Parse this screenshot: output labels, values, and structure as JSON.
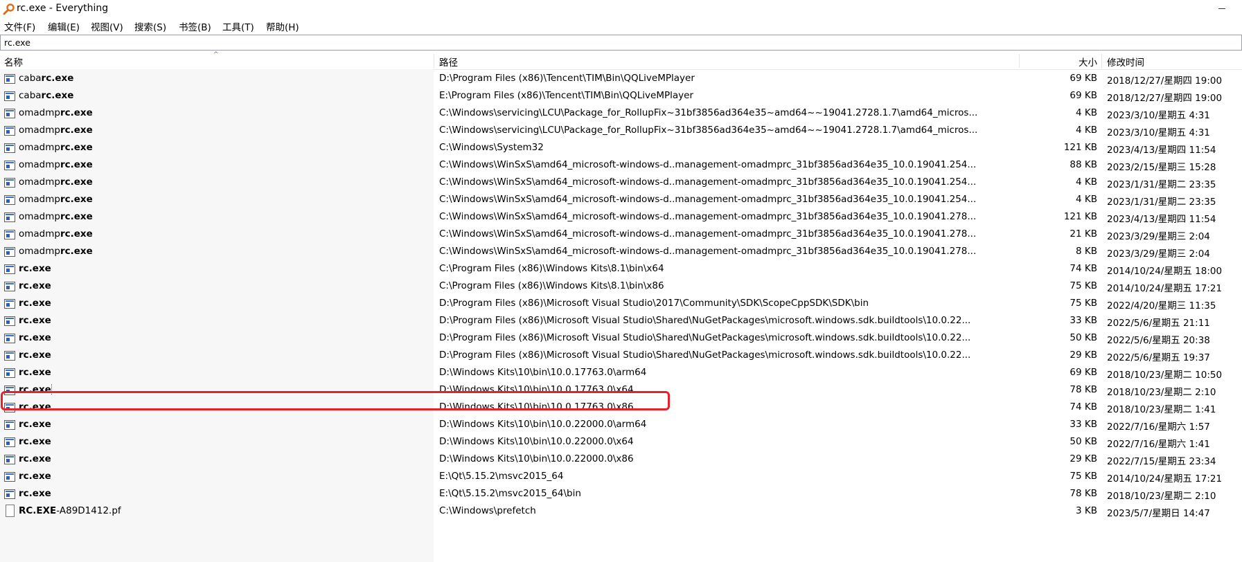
{
  "window": {
    "title": "rc.exe - Everything"
  },
  "menu": [
    {
      "label": "文件(F)"
    },
    {
      "label": "编辑(E)"
    },
    {
      "label": "视图(V)"
    },
    {
      "label": "搜索(S)"
    },
    {
      "label": "书签(B)"
    },
    {
      "label": "工具(T)"
    },
    {
      "label": "帮助(H)"
    }
  ],
  "search": {
    "value": "rc.exe"
  },
  "columns": {
    "name": "名称",
    "path": "路径",
    "size": "大小",
    "modified": "修改时间"
  },
  "colors": {
    "annotation": "#e8202a",
    "icon_blue": "#2d5fb8"
  },
  "annotation": {
    "highlighted_row_index": 18
  },
  "rows": [
    {
      "prefix": "caba",
      "match": "rc.exe",
      "suffix": "",
      "icon": "exe-icon",
      "path": "D:\\Program Files (x86)\\Tencent\\TIM\\Bin\\QQLiveMPlayer",
      "size": "69 KB",
      "modified": "2018/12/27/星期四 19:00"
    },
    {
      "prefix": "caba",
      "match": "rc.exe",
      "suffix": "",
      "icon": "exe-icon",
      "path": "E:\\Program Files (x86)\\Tencent\\TIM\\Bin\\QQLiveMPlayer",
      "size": "69 KB",
      "modified": "2018/12/27/星期四 19:00"
    },
    {
      "prefix": "omadmp",
      "match": "rc.exe",
      "suffix": "",
      "icon": "exe-icon",
      "path": "C:\\Windows\\servicing\\LCU\\Package_for_RollupFix~31bf3856ad364e35~amd64~~19041.2728.1.7\\amd64_micros...",
      "size": "4 KB",
      "modified": "2023/3/10/星期五 4:31"
    },
    {
      "prefix": "omadmp",
      "match": "rc.exe",
      "suffix": "",
      "icon": "exe-icon",
      "path": "C:\\Windows\\servicing\\LCU\\Package_for_RollupFix~31bf3856ad364e35~amd64~~19041.2728.1.7\\amd64_micros...",
      "size": "4 KB",
      "modified": "2023/3/10/星期五 4:31"
    },
    {
      "prefix": "omadmp",
      "match": "rc.exe",
      "suffix": "",
      "icon": "exe-icon",
      "path": "C:\\Windows\\System32",
      "size": "121 KB",
      "modified": "2023/4/13/星期四 11:54"
    },
    {
      "prefix": "omadmp",
      "match": "rc.exe",
      "suffix": "",
      "icon": "exe-icon",
      "path": "C:\\Windows\\WinSxS\\amd64_microsoft-windows-d..management-omadmprc_31bf3856ad364e35_10.0.19041.254...",
      "size": "88 KB",
      "modified": "2023/2/15/星期三 15:28"
    },
    {
      "prefix": "omadmp",
      "match": "rc.exe",
      "suffix": "",
      "icon": "exe-icon",
      "path": "C:\\Windows\\WinSxS\\amd64_microsoft-windows-d..management-omadmprc_31bf3856ad364e35_10.0.19041.254...",
      "size": "4 KB",
      "modified": "2023/1/31/星期二 23:35"
    },
    {
      "prefix": "omadmp",
      "match": "rc.exe",
      "suffix": "",
      "icon": "exe-icon",
      "path": "C:\\Windows\\WinSxS\\amd64_microsoft-windows-d..management-omadmprc_31bf3856ad364e35_10.0.19041.254...",
      "size": "4 KB",
      "modified": "2023/1/31/星期二 23:35"
    },
    {
      "prefix": "omadmp",
      "match": "rc.exe",
      "suffix": "",
      "icon": "exe-icon",
      "path": "C:\\Windows\\WinSxS\\amd64_microsoft-windows-d..management-omadmprc_31bf3856ad364e35_10.0.19041.278...",
      "size": "121 KB",
      "modified": "2023/4/13/星期四 11:54"
    },
    {
      "prefix": "omadmp",
      "match": "rc.exe",
      "suffix": "",
      "icon": "exe-icon",
      "path": "C:\\Windows\\WinSxS\\amd64_microsoft-windows-d..management-omadmprc_31bf3856ad364e35_10.0.19041.278...",
      "size": "21 KB",
      "modified": "2023/3/29/星期三 2:04"
    },
    {
      "prefix": "omadmp",
      "match": "rc.exe",
      "suffix": "",
      "icon": "exe-icon",
      "path": "C:\\Windows\\WinSxS\\amd64_microsoft-windows-d..management-omadmprc_31bf3856ad364e35_10.0.19041.278...",
      "size": "8 KB",
      "modified": "2023/3/29/星期三 2:04"
    },
    {
      "prefix": "",
      "match": "rc.exe",
      "suffix": "",
      "icon": "exe-icon",
      "path": "C:\\Program Files (x86)\\Windows Kits\\8.1\\bin\\x64",
      "size": "74 KB",
      "modified": "2014/10/24/星期五 18:00"
    },
    {
      "prefix": "",
      "match": "rc.exe",
      "suffix": "",
      "icon": "exe-icon",
      "path": "C:\\Program Files (x86)\\Windows Kits\\8.1\\bin\\x86",
      "size": "75 KB",
      "modified": "2014/10/24/星期五 17:21"
    },
    {
      "prefix": "",
      "match": "rc.exe",
      "suffix": "",
      "icon": "exe-icon",
      "path": "D:\\Program Files (x86)\\Microsoft Visual Studio\\2017\\Community\\SDK\\ScopeCppSDK\\SDK\\bin",
      "size": "75 KB",
      "modified": "2022/4/20/星期三 11:35"
    },
    {
      "prefix": "",
      "match": "rc.exe",
      "suffix": "",
      "icon": "exe-icon",
      "path": "D:\\Program Files (x86)\\Microsoft Visual Studio\\Shared\\NuGetPackages\\microsoft.windows.sdk.buildtools\\10.0.22...",
      "size": "33 KB",
      "modified": "2022/5/6/星期五 21:11"
    },
    {
      "prefix": "",
      "match": "rc.exe",
      "suffix": "",
      "icon": "exe-icon",
      "path": "D:\\Program Files (x86)\\Microsoft Visual Studio\\Shared\\NuGetPackages\\microsoft.windows.sdk.buildtools\\10.0.22...",
      "size": "50 KB",
      "modified": "2022/5/6/星期五 20:38"
    },
    {
      "prefix": "",
      "match": "rc.exe",
      "suffix": "",
      "icon": "exe-icon",
      "path": "D:\\Program Files (x86)\\Microsoft Visual Studio\\Shared\\NuGetPackages\\microsoft.windows.sdk.buildtools\\10.0.22...",
      "size": "29 KB",
      "modified": "2022/5/6/星期五 19:37"
    },
    {
      "prefix": "",
      "match": "rc.exe",
      "suffix": "",
      "icon": "exe-icon",
      "path": "D:\\Windows Kits\\10\\bin\\10.0.17763.0\\arm64",
      "size": "69 KB",
      "modified": "2018/10/23/星期二 10:50"
    },
    {
      "prefix": "",
      "match": "rc.exe",
      "suffix": "",
      "icon": "exe-icon",
      "path": "D:\\Windows Kits\\10\\bin\\10.0.17763.0\\x64",
      "size": "78 KB",
      "modified": "2018/10/23/星期二 2:10"
    },
    {
      "prefix": "",
      "match": "rc.exe",
      "suffix": "",
      "icon": "exe-icon",
      "path": "D:\\Windows Kits\\10\\bin\\10.0.17763.0\\x86",
      "size": "74 KB",
      "modified": "2018/10/23/星期二 1:41"
    },
    {
      "prefix": "",
      "match": "rc.exe",
      "suffix": "",
      "icon": "exe-icon",
      "path": "D:\\Windows Kits\\10\\bin\\10.0.22000.0\\arm64",
      "size": "33 KB",
      "modified": "2022/7/16/星期六 1:57"
    },
    {
      "prefix": "",
      "match": "rc.exe",
      "suffix": "",
      "icon": "exe-icon",
      "path": "D:\\Windows Kits\\10\\bin\\10.0.22000.0\\x64",
      "size": "50 KB",
      "modified": "2022/7/16/星期六 1:41"
    },
    {
      "prefix": "",
      "match": "rc.exe",
      "suffix": "",
      "icon": "exe-icon",
      "path": "D:\\Windows Kits\\10\\bin\\10.0.22000.0\\x86",
      "size": "29 KB",
      "modified": "2022/7/15/星期五 23:34"
    },
    {
      "prefix": "",
      "match": "rc.exe",
      "suffix": "",
      "icon": "exe-icon",
      "path": "E:\\Qt\\5.15.2\\msvc2015_64",
      "size": "75 KB",
      "modified": "2014/10/24/星期五 17:21"
    },
    {
      "prefix": "",
      "match": "rc.exe",
      "suffix": "",
      "icon": "exe-icon",
      "path": "E:\\Qt\\5.15.2\\msvc2015_64\\bin",
      "size": "78 KB",
      "modified": "2018/10/23/星期二 2:10"
    },
    {
      "prefix": "",
      "match": "RC.EXE",
      "suffix": "-A89D1412.pf",
      "icon": "doc-icon",
      "path": "C:\\Windows\\prefetch",
      "size": "3 KB",
      "modified": "2023/5/7/星期日 14:47"
    }
  ]
}
